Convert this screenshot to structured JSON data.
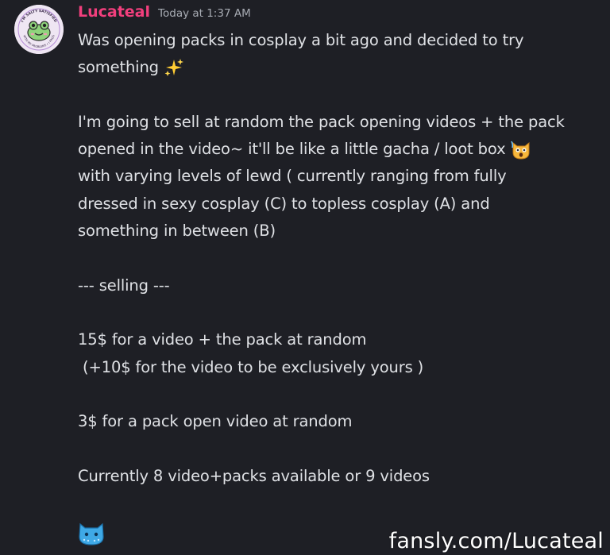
{
  "message": {
    "author": "Lucateal",
    "timestamp": "Today at 1:37 AM",
    "author_color": "#f23f7d",
    "avatar": {
      "icon": "frog-badge-icon",
      "top_text": "I'M SALTY SATISFIED",
      "bottom_text": "WITH MY PROBLEMS • I FROG"
    },
    "lines": [
      "Was opening packs in cosplay a bit ago and decided to try",
      "something",
      "",
      "I'm going to sell at random the pack opening videos + the pack",
      "opened in the video~ it'll be like a little gacha / loot box",
      "with varying levels of lewd ( currently ranging from fully",
      "dressed in sexy cosplay (C) to topless cosplay (A) and",
      "something in between (B)",
      "",
      "--- selling ---",
      "",
      "15$ for a video + the pack at random",
      " (+10$ for the video to be exclusively yours )",
      "",
      "3$ for a pack open video at random",
      "",
      "Currently 8 video+packs available or 9 videos",
      ""
    ],
    "emojis": {
      "sparkles": "sparkles-icon",
      "cat": "scared-cat-icon",
      "big": "blue-cat-blob-icon"
    }
  },
  "watermark": "fansly.com/Lucateal"
}
